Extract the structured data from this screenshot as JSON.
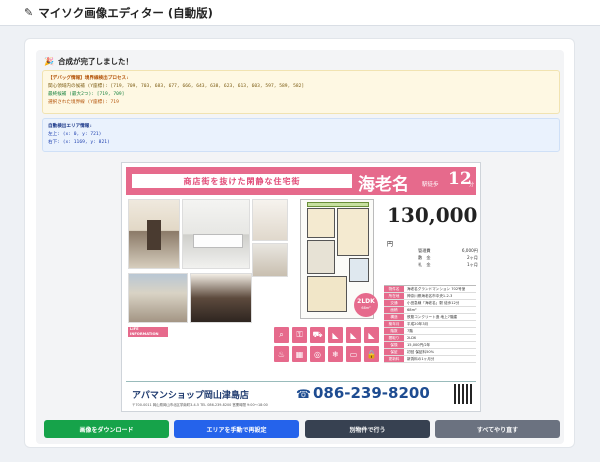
{
  "header": {
    "title": "マイソク画像エディター (自動版)"
  },
  "status": {
    "message": "合成が完了しました！"
  },
  "debug": {
    "title": "【デバッグ情報】境界線検出プロセス:",
    "line1": "関心領域内の候補 (Y座標): [719, 709, 703, 683, 677, 666, 643, 638, 623, 613, 603, 597, 589, 582]",
    "line2": "最終候補 (最大2つ): [719, 709]",
    "line3": "選択された境界線 (Y座標): 719"
  },
  "area": {
    "title": "自動検出エリア情報:",
    "top_left": "左上: (x: 0, y: 721)",
    "bottom_right": "右下: (x: 1169, y: 821)"
  },
  "flyer": {
    "banner_tag": "商店街を抜けた閑静な住宅街",
    "station": "海老名",
    "walk_label": "駅徒歩",
    "walk_minutes": "12",
    "minutes_unit": "分",
    "price": "130,000",
    "price_unit": "円",
    "fees": [
      {
        "label": "管理費",
        "value": "6,000円"
      },
      {
        "label": "敷　金",
        "value": "2ヶ月"
      },
      {
        "label": "礼　金",
        "value": "1ヶ月"
      }
    ],
    "layout_badge": "2LDK",
    "layout_size": "68m²",
    "spec": [
      {
        "k": "物件名",
        "v": "海老名グランドマンション 702号室"
      },
      {
        "k": "所在地",
        "v": "神奈川県海老名市中央1-2-3"
      },
      {
        "k": "交通",
        "v": "小田急線「海老名」駅 徒歩12分"
      },
      {
        "k": "面積",
        "v": "68m²"
      },
      {
        "k": "構造",
        "v": "鉄筋コンクリート造 地上7階建"
      },
      {
        "k": "築年月",
        "v": "平成20年3月"
      },
      {
        "k": "階数",
        "v": "7階"
      },
      {
        "k": "間取り",
        "v": "2LDK"
      },
      {
        "k": "保険",
        "v": "15,000円/2年"
      },
      {
        "k": "保証",
        "v": "初回 保証料50%"
      },
      {
        "k": "更新料",
        "v": "新賃料の1ヶ月分"
      }
    ],
    "life_info_title": "LIFE INFORMATION",
    "shop_name": "アパマンショップ岡山津島店",
    "tel": "086-239-8200",
    "address": "〒700-0011 岡山県岡山市北区学南町3-4-5 TEL 086-239-8200 営業時間 9:00〜18:00"
  },
  "buttons": {
    "download": "画像をダウンロード",
    "manual": "エリアを手動で再設定",
    "other": "別物件で行う",
    "reset": "すべてやり直す"
  }
}
